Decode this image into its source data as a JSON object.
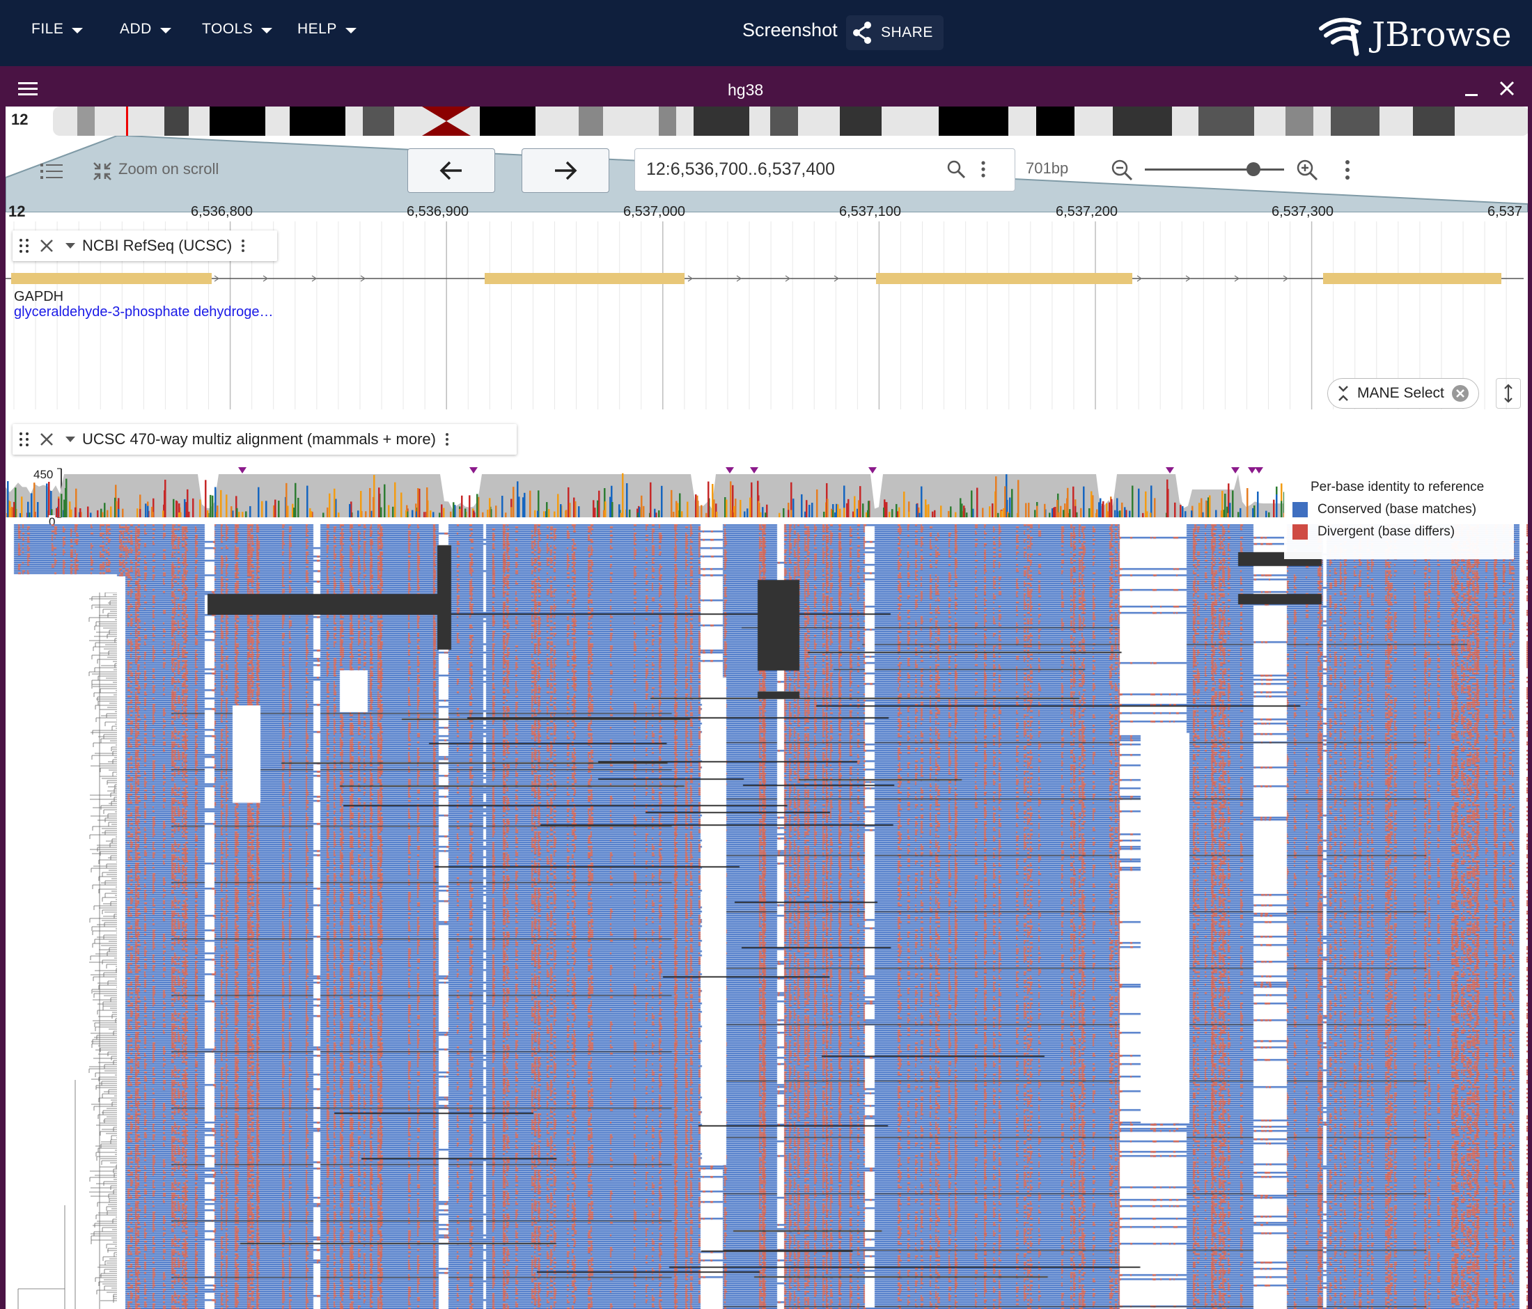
{
  "menu": {
    "file": "FILE",
    "add": "ADD",
    "tools": "TOOLS",
    "help": "HELP"
  },
  "header": {
    "screenshot_label": "Screenshot",
    "share_label": "SHARE",
    "logo_text": "JBrowse"
  },
  "view": {
    "assembly": "hg38",
    "chromosome": "12",
    "zoom_on_scroll": "Zoom on scroll",
    "locstring": "12:6,536,700..6,537,400",
    "bp_width": "701bp",
    "zoom_level_fraction": 0.78
  },
  "ruler": {
    "chrom": "12",
    "ticks": [
      "6,536,800",
      "6,536,900",
      "6,537,000",
      "6,537,100",
      "6,537,200",
      "6,537,300",
      "6,537"
    ]
  },
  "tracks": {
    "refseq": {
      "name": "NCBI RefSeq (UCSC)",
      "gene_name": "GAPDH",
      "gene_description": "glyceraldehyde-3-phosphate dehydroge…",
      "filter_chip": "MANE Select"
    },
    "multiz": {
      "name": "UCSC 470-way multiz alignment (mammals + more)",
      "y_max": "450",
      "y_min": "0"
    }
  },
  "legend": {
    "title": "Per-base identity to reference",
    "conserved": "Conserved (base matches)",
    "divergent": "Divergent (base differs)",
    "colors": {
      "conserved": "#3f6fc0",
      "divergent": "#cf4b43"
    }
  },
  "colors": {
    "appbar": "#0f1f3d",
    "view_frame": "#4a1344",
    "exon": "#e8c778",
    "conserved": "#4a78c8",
    "divergent": "#d2604f",
    "gap": "#333333"
  }
}
